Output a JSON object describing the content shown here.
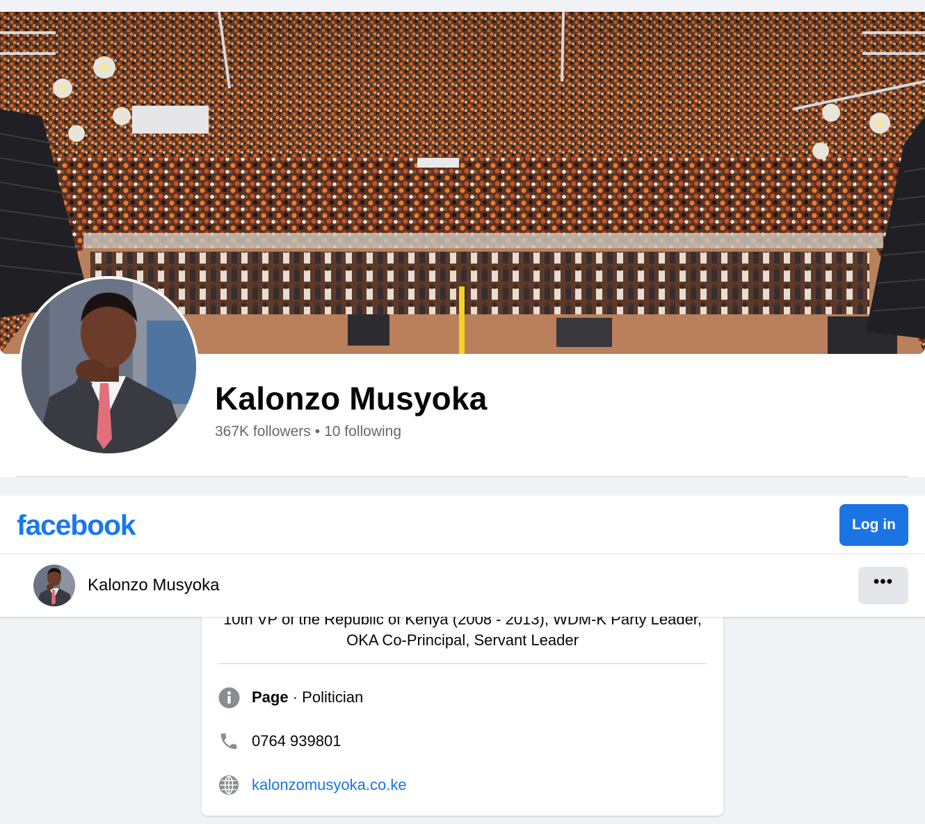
{
  "profile": {
    "name": "Kalonzo Musyoka",
    "followers": "367K followers",
    "separator": "•",
    "following": "10 following"
  },
  "topbar": {
    "logo": "facebook",
    "login_label": "Log in"
  },
  "page_bar": {
    "name": "Kalonzo Musyoka",
    "more_label": "•••"
  },
  "intro": {
    "bio_line1": "10th VP of the Republic of Kenya (2008 - 2013), WDM-K Party Leader,",
    "bio_line2": "OKA Co-Principal, Servant Leader",
    "category_prefix": "Page",
    "category_sep": " · ",
    "category": "Politician",
    "phone": "0764 939801",
    "website": "kalonzomusyoka.co.ke",
    "icons": [
      "info-icon",
      "phone-icon",
      "globe-icon"
    ]
  },
  "colors": {
    "brand_blue": "#1877f2",
    "button_blue": "#1b74e4",
    "link_blue": "#1b74e4",
    "secondary_text": "#65676b",
    "page_bg": "#f0f2f5",
    "gray_button": "#e4e6eb"
  }
}
